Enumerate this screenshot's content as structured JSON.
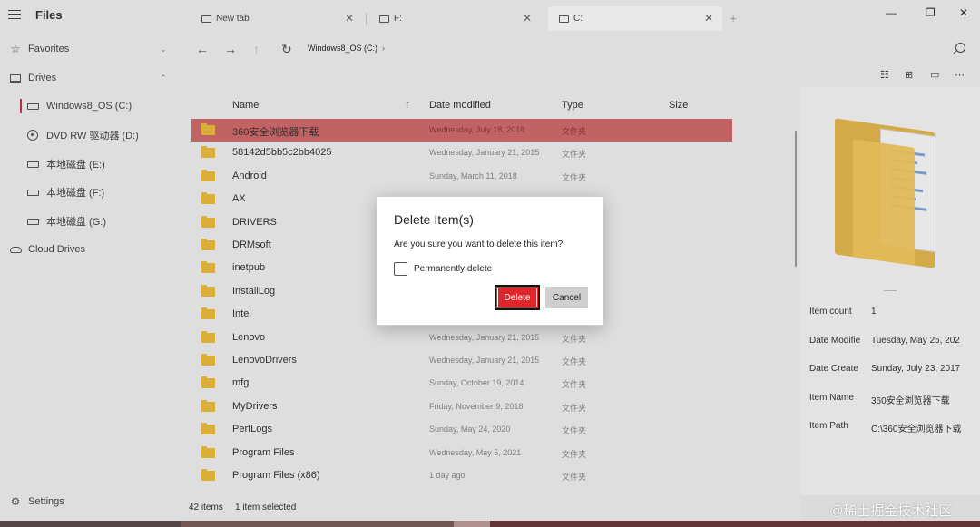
{
  "app": {
    "title": "Files"
  },
  "sidebar": {
    "favorites": "Favorites",
    "drives": "Drives",
    "drive_items": [
      {
        "label": "Windows8_OS (C:)",
        "icon": "drive-icon"
      },
      {
        "label": "DVD RW 驱动器 (D:)",
        "icon": "disc-icon"
      },
      {
        "label": "本地磁盘 (E:)",
        "icon": "drive-icon"
      },
      {
        "label": "本地磁盘 (F:)",
        "icon": "drive-icon"
      },
      {
        "label": "本地磁盘 (G:)",
        "icon": "drive-icon"
      }
    ],
    "cloud_drives": "Cloud Drives",
    "settings": "Settings"
  },
  "tabs": [
    {
      "label": "New tab"
    },
    {
      "label": "F:"
    },
    {
      "label": "C:"
    }
  ],
  "address": {
    "crumb": "Windows8_OS (C:)",
    "crumb_sep": "›"
  },
  "columns": {
    "name": "Name",
    "date": "Date modified",
    "type": "Type",
    "size": "Size"
  },
  "files": [
    {
      "name": "360安全浏览器下载",
      "date": "Wednesday, July 18, 2018",
      "type": "文件夹"
    },
    {
      "name": "58142d5bb5c2bb4025",
      "date": "Wednesday, January 21, 2015",
      "type": "文件夹"
    },
    {
      "name": "Android",
      "date": "Sunday, March 11, 2018",
      "type": "文件夹"
    },
    {
      "name": "AX",
      "date": "",
      "type": ""
    },
    {
      "name": "DRIVERS",
      "date": "",
      "type": ""
    },
    {
      "name": "DRMsoft",
      "date": "",
      "type": ""
    },
    {
      "name": "inetpub",
      "date": "",
      "type": ""
    },
    {
      "name": "InstallLog",
      "date": "",
      "type": ""
    },
    {
      "name": "Intel",
      "date": "",
      "type": ""
    },
    {
      "name": "Lenovo",
      "date": "Wednesday, January 21, 2015",
      "type": "文件夹"
    },
    {
      "name": "LenovoDrivers",
      "date": "Wednesday, January 21, 2015",
      "type": "文件夹"
    },
    {
      "name": "mfg",
      "date": "Sunday, October 19, 2014",
      "type": "文件夹"
    },
    {
      "name": "MyDrivers",
      "date": "Friday, November 9, 2018",
      "type": "文件夹"
    },
    {
      "name": "PerfLogs",
      "date": "Sunday, May 24, 2020",
      "type": "文件夹"
    },
    {
      "name": "Program Files",
      "date": "Wednesday, May 5, 2021",
      "type": "文件夹"
    },
    {
      "name": "Program Files (x86)",
      "date": "1 day ago",
      "type": "文件夹"
    }
  ],
  "status": {
    "count": "42 items",
    "selected": "1 item selected"
  },
  "preview": {
    "details": [
      {
        "key": "Item count",
        "value": "1"
      },
      {
        "key": "Date Modifie",
        "value": "Tuesday, May 25, 202"
      },
      {
        "key": "Date Create",
        "value": "Sunday, July 23, 2017"
      },
      {
        "key": "Item Name",
        "value": "360安全浏览器下载"
      },
      {
        "key": "Item Path",
        "value": "C:\\360安全浏览器下载"
      }
    ]
  },
  "dialog": {
    "title": "Delete Item(s)",
    "message": "Are you sure you want to delete this item?",
    "checkbox_label": "Permanently delete",
    "delete_label": "Delete",
    "cancel_label": "Cancel"
  },
  "watermark": "@稀土掘金技术社区",
  "colors": {
    "accent": "#c4314b",
    "selected_row": "#cf6a6a",
    "delete_button": "#e0262a"
  }
}
